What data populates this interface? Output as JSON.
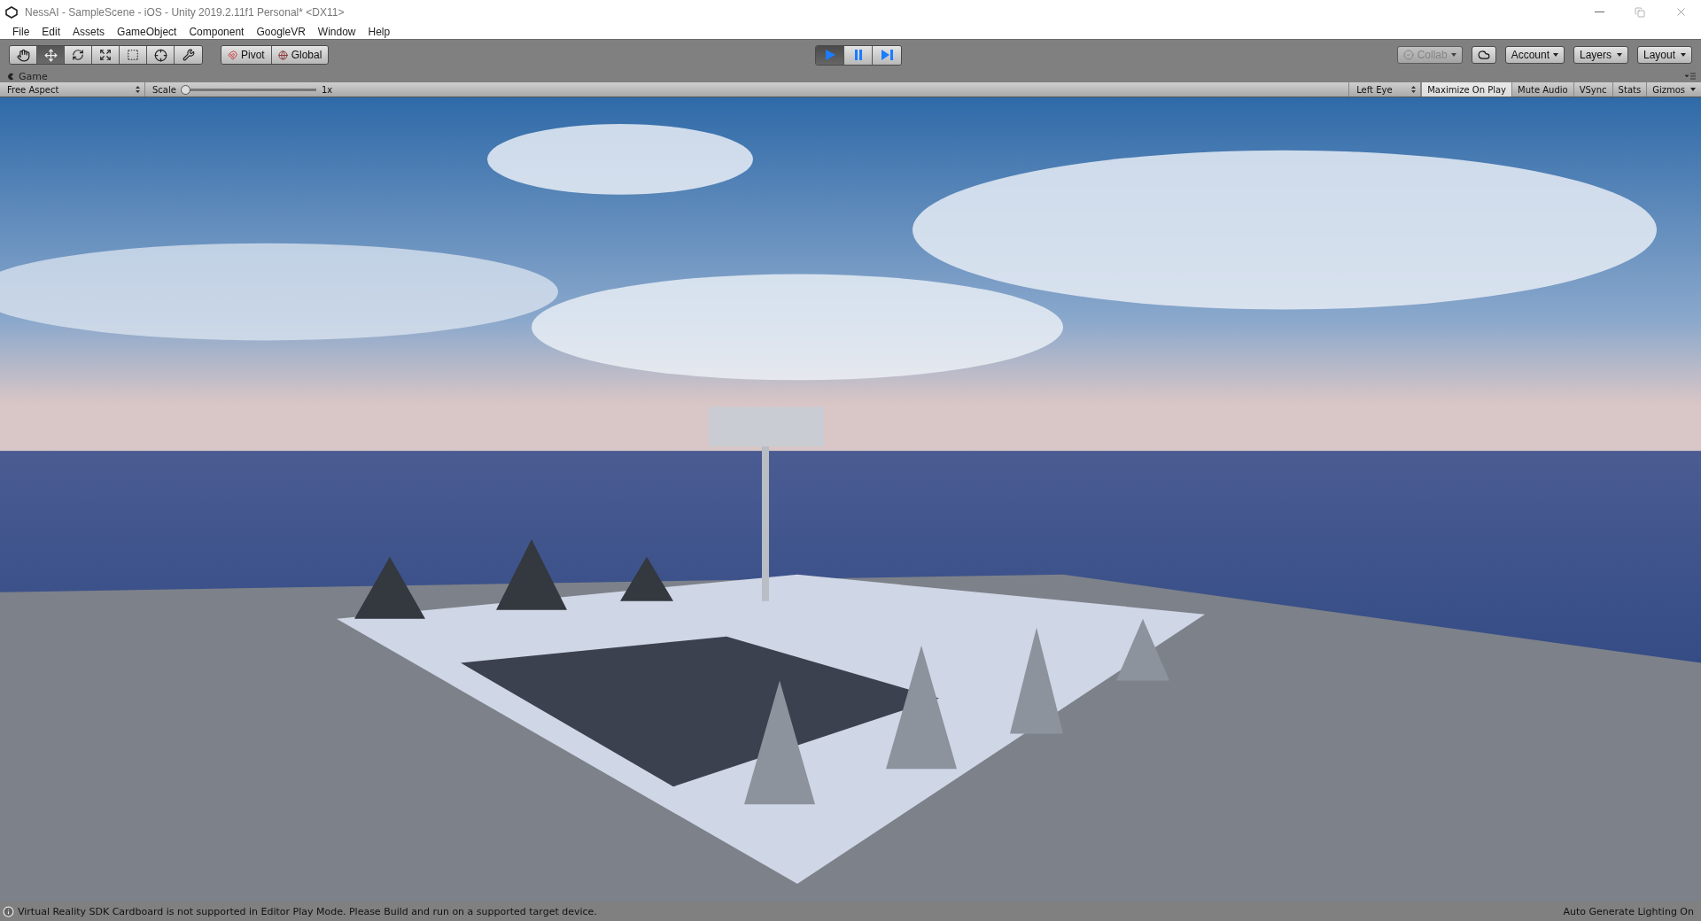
{
  "window": {
    "title": "NessAI - SampleScene - iOS - Unity 2019.2.11f1 Personal* <DX11>"
  },
  "menu": [
    "File",
    "Edit",
    "Assets",
    "GameObject",
    "Component",
    "GoogleVR",
    "Window",
    "Help"
  ],
  "tools": [
    {
      "kind": "hand",
      "selected": false
    },
    {
      "kind": "move",
      "selected": true
    },
    {
      "kind": "rotate",
      "selected": false
    },
    {
      "kind": "scale",
      "selected": false
    },
    {
      "kind": "rect",
      "selected": false
    },
    {
      "kind": "transform",
      "selected": false
    },
    {
      "kind": "custom",
      "selected": false
    }
  ],
  "handles": [
    {
      "kind": "pivot",
      "label": "Pivot"
    },
    {
      "kind": "global",
      "label": "Global"
    }
  ],
  "playback": [
    {
      "kind": "play",
      "on": true
    },
    {
      "kind": "pause",
      "on": false
    },
    {
      "kind": "step",
      "on": false
    }
  ],
  "collab": {
    "label": "Collab",
    "disabled": true
  },
  "dropdowns": [
    "Account",
    "Layers",
    "Layout"
  ],
  "game_tab": {
    "label": "Game"
  },
  "game_toolbar": {
    "aspect": "Free Aspect",
    "scale_label": "Scale",
    "scale": {
      "level": 0.0
    },
    "scale_reading": "1x",
    "eye": "Left Eye",
    "toggles": [
      {
        "label": "Maximize On Play",
        "on": true
      },
      {
        "label": "Mute Audio",
        "on": false
      },
      {
        "label": "VSync",
        "on": false
      },
      {
        "label": "Stats",
        "on": false
      }
    ],
    "gizmos": "Gizmos"
  },
  "viewport": {
    "kind": "picture"
  },
  "status_bar": {
    "message": "Virtual Reality SDK Cardboard is not supported in Editor Play Mode. Please Build and run on a supported target device.",
    "right": "Auto Generate Lighting On"
  }
}
